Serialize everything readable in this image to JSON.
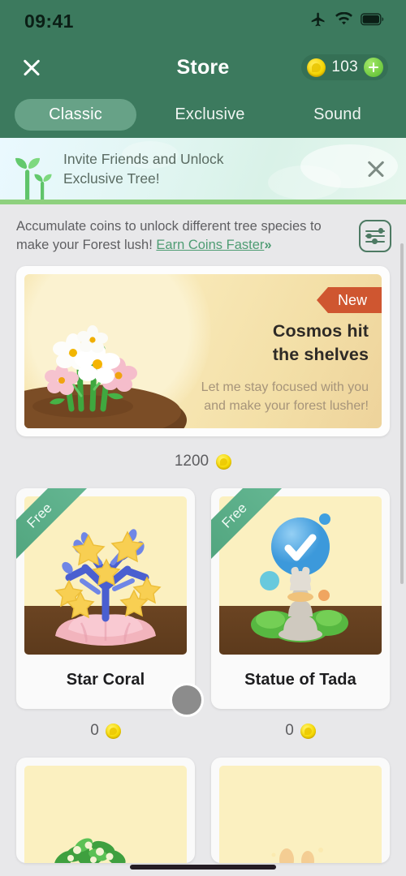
{
  "status_bar": {
    "time": "09:41",
    "icons": [
      "airplane-mode-icon",
      "wifi-icon",
      "battery-icon"
    ]
  },
  "header": {
    "close_label": "close-icon",
    "title": "Store",
    "coin_count": "103",
    "coin_icon": "coin-icon",
    "add_coins_label": "plus-icon",
    "background_color": "#3c7a5e"
  },
  "tabs": [
    {
      "label": "Classic",
      "active": true
    },
    {
      "label": "Exclusive",
      "active": false
    },
    {
      "label": "Sound",
      "active": false
    }
  ],
  "invite_banner": {
    "icon": "sprout-icon",
    "line1": "Invite Friends and Unlock",
    "line2": "Exclusive Tree!",
    "close_label": "close-icon"
  },
  "description": {
    "text": "Accumulate coins to unlock different tree species to make your Forest lush!",
    "link_text": "Earn Coins Faster",
    "link_chevrons": "»",
    "filter_icon": "sliders-filter-icon"
  },
  "featured": {
    "badge": "New",
    "badge_color": "#cf5630",
    "title_line1": "Cosmos hit",
    "title_line2": "the shelves",
    "subtitle": "Let me stay focused with you and make your forest lusher!",
    "art": "cosmos-flowers-illustration",
    "price": "1200",
    "price_icon": "coin-icon"
  },
  "items": [
    {
      "name": "Star Coral",
      "badge": "Free",
      "price": "0",
      "price_icon": "coin-icon",
      "art": "star-coral-illustration"
    },
    {
      "name": "Statue of Tada",
      "badge": "Free",
      "price": "0",
      "price_icon": "coin-icon",
      "art": "statue-of-tada-illustration"
    }
  ],
  "items_partial": [
    {
      "art": "white-flowering-shrub-illustration"
    },
    {
      "art": "golden-tree-illustration"
    }
  ],
  "colors": {
    "brand_green": "#3c7a5e",
    "accent_green": "#4e9c73",
    "banner_border": "#8ed07e",
    "page_bg": "#e8e8ea",
    "card_bg": "#fafafa",
    "thumb_bg": "#fbf0c0",
    "soil_brown": "#5c3a1c",
    "coin_yellow": "#f5d800",
    "ribbon_red": "#cf5630"
  }
}
